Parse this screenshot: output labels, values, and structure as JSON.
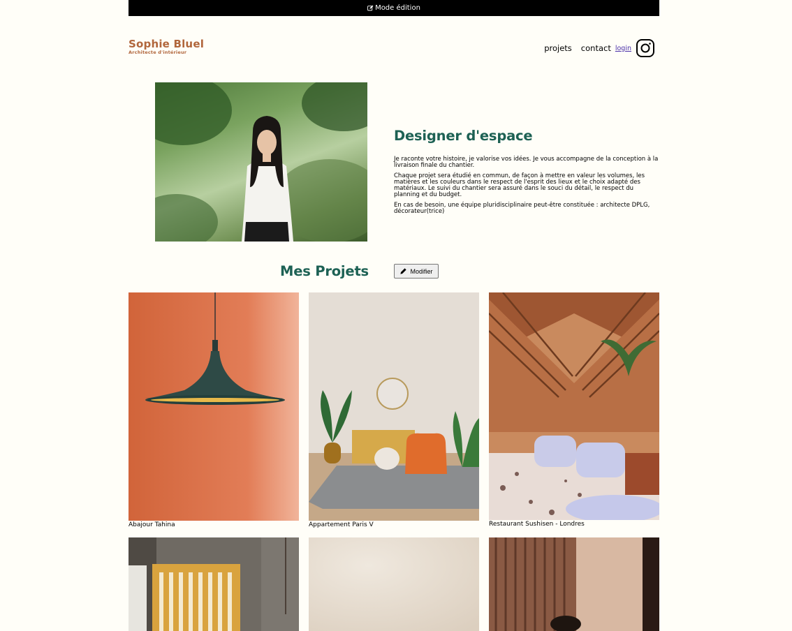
{
  "edit_bar": {
    "label": "Mode édition",
    "icon": "edit-square-icon"
  },
  "header": {
    "logo_name": "Sophie Bluel",
    "logo_subtitle": "Architecte d'intérieur",
    "nav": {
      "projets": "projets",
      "contact": "contact",
      "login": "login",
      "instagram_icon": "instagram-icon"
    }
  },
  "intro": {
    "title": "Designer d'espace",
    "paragraphs": [
      "Je raconte votre histoire, je valorise vos idées. Je vous accompagne de la conception à la livraison finale du chantier.",
      "Chaque projet sera étudié en commun, de façon à mettre en valeur les volumes, les matières et les couleurs dans le respect de l'esprit des lieux et le choix adapté des matériaux. Le suivi du chantier sera assuré dans le souci du détail, le respect du planning et du budget.",
      "En cas de besoin, une équipe pluridisciplinaire peut-être constituée : architecte DPLG, décorateur(trice)"
    ]
  },
  "projects": {
    "title": "Mes Projets",
    "modify_label": "Modifier",
    "items": [
      {
        "caption": "Abajour Tahina"
      },
      {
        "caption": "Appartement Paris V"
      },
      {
        "caption": "Restaurant Sushisen - Londres"
      },
      {
        "caption": ""
      },
      {
        "caption": ""
      },
      {
        "caption": ""
      }
    ]
  },
  "colors": {
    "brand_green": "#1D6154",
    "brand_orange": "#B1663C",
    "background": "#FFFEF8"
  }
}
